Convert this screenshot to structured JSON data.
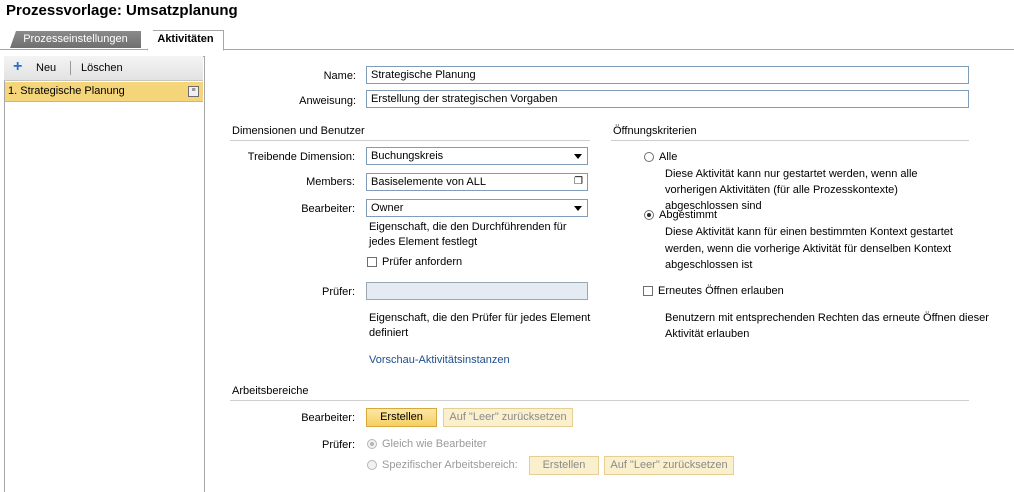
{
  "title": "Prozessvorlage: Umsatzplanung",
  "tabs": [
    {
      "label": "Prozesseinstellungen"
    },
    {
      "label": "Aktivitäten"
    }
  ],
  "toolbar": {
    "new_label": "Neu",
    "delete_label": "Löschen"
  },
  "activities": [
    {
      "label": "1.  Strategische Planung"
    }
  ],
  "form": {
    "name_label": "Name:",
    "name_value": "Strategische Planung",
    "instruction_label": "Anweisung:",
    "instruction_value": "Erstellung der strategischen Vorgaben"
  },
  "dimensions": {
    "section_title": "Dimensionen und Benutzer",
    "driving_dim_label": "Treibende Dimension:",
    "driving_dim_value": "Buchungskreis",
    "members_label": "Members:",
    "members_value": "Basiselemente von ALL",
    "editor_label": "Bearbeiter:",
    "editor_value": "Owner",
    "editor_note_1": "Eigenschaft, die den Durchführenden für",
    "editor_note_2": "jedes Element festlegt",
    "require_reviewer_label": "Prüfer anfordern",
    "reviewer_label": "Prüfer:",
    "reviewer_value": "",
    "reviewer_note_1": "Eigenschaft, die den Prüfer für jedes Element",
    "reviewer_note_2": "definiert",
    "preview_link": "Vorschau-Aktivitätsinstanzen"
  },
  "opening": {
    "section_title": "Öffnungskriterien",
    "all_label": "Alle",
    "all_desc_1": "Diese Aktivität kann nur gestartet werden, wenn alle",
    "all_desc_2": "vorherigen Aktivitäten (für alle Prozesskontexte)",
    "all_desc_3": "abgeschlossen sind",
    "matched_label": "Abgestimmt",
    "matched_desc_1": "Diese Aktivität kann für einen bestimmten Kontext gestartet",
    "matched_desc_2": "werden, wenn die vorherige Aktivität für denselben Kontext",
    "matched_desc_3": "abgeschlossen ist",
    "reopen_label": "Erneutes Öffnen erlauben",
    "reopen_desc_1": "Benutzern mit entsprechenden Rechten das erneute Öffnen dieser",
    "reopen_desc_2": "Aktivität erlauben"
  },
  "workspaces": {
    "section_title": "Arbeitsbereiche",
    "editor_label": "Bearbeiter:",
    "create_label": "Erstellen",
    "reset_label": "Auf \"Leer\" zurücksetzen",
    "reviewer_label": "Prüfer:",
    "same_as_editor_label": "Gleich wie Bearbeiter",
    "specific_label": "Spezifischer Arbeitsbereich:",
    "create2_label": "Erstellen",
    "reset2_label": "Auf \"Leer\" zurücksetzen"
  }
}
